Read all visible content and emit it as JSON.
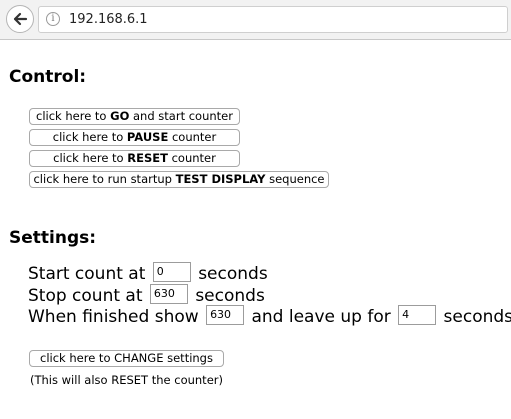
{
  "browser": {
    "url": "192.168.6.1",
    "info_symbol": "i"
  },
  "control": {
    "heading": "Control:",
    "go": {
      "prefix": "click here to ",
      "bold": "GO",
      "suffix": " and start counter"
    },
    "pause": {
      "prefix": "click here to ",
      "bold": "PAUSE",
      "suffix": " counter"
    },
    "reset": {
      "prefix": "click here to ",
      "bold": "RESET",
      "suffix": " counter"
    },
    "test": {
      "prefix": "click here to run startup ",
      "bold": "TEST DISPLAY",
      "suffix": " sequence"
    }
  },
  "settings": {
    "heading": "Settings:",
    "start": {
      "label": "Start count at",
      "value": "0",
      "unit": "seconds"
    },
    "stop": {
      "label": "Stop count at",
      "value": "630",
      "unit": "seconds"
    },
    "finish": {
      "label": "When finished show",
      "show_value": "630",
      "middle": "and leave up for",
      "leave_value": "4",
      "unit": "seconds"
    },
    "change_button": "click here to CHANGE settings",
    "note": "(This will also RESET the counter)"
  }
}
